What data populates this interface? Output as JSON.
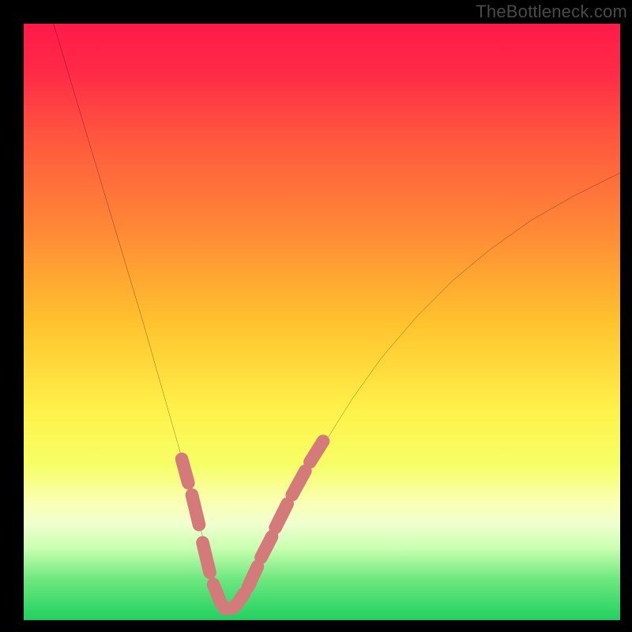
{
  "watermark": "TheBottleneck.com",
  "colors": {
    "frame_bg": "#000000",
    "gradient_stops": [
      {
        "offset": 0.0,
        "color": "#ff1a4a"
      },
      {
        "offset": 0.08,
        "color": "#ff2a47"
      },
      {
        "offset": 0.2,
        "color": "#ff5a3e"
      },
      {
        "offset": 0.35,
        "color": "#ff8a36"
      },
      {
        "offset": 0.5,
        "color": "#ffc22e"
      },
      {
        "offset": 0.65,
        "color": "#fff24a"
      },
      {
        "offset": 0.74,
        "color": "#f6ff66"
      },
      {
        "offset": 0.8,
        "color": "#faffb0"
      },
      {
        "offset": 0.84,
        "color": "#f0ffd0"
      },
      {
        "offset": 0.88,
        "color": "#c8ffb0"
      },
      {
        "offset": 0.93,
        "color": "#70e880"
      },
      {
        "offset": 1.0,
        "color": "#20d060"
      }
    ],
    "curve": "#000000",
    "marker_fill": "#d47a7a",
    "marker_stroke": "#c96a6a"
  },
  "chart_data": {
    "type": "line",
    "title": "",
    "xlabel": "",
    "ylabel": "",
    "xlim": [
      0,
      100
    ],
    "ylim": [
      0,
      100
    ],
    "series": [
      {
        "name": "bottleneck-curve",
        "x": [
          5,
          8,
          11,
          14,
          17,
          20,
          22,
          24,
          26,
          28,
          29,
          30,
          31,
          32,
          33,
          34,
          35,
          36,
          38,
          40,
          43,
          46,
          50,
          55,
          60,
          66,
          72,
          78,
          85,
          92,
          100
        ],
        "y": [
          100,
          90,
          80,
          70,
          60,
          50,
          43,
          36,
          29,
          22,
          18,
          14,
          10,
          7,
          4,
          2,
          2,
          3,
          6,
          10,
          16,
          22,
          29,
          37,
          44,
          51,
          57,
          62,
          67,
          71,
          75
        ]
      }
    ],
    "markers": {
      "name": "highlight-segments",
      "segments": [
        {
          "x0": 26.5,
          "y0": 27,
          "x1": 27.6,
          "y1": 23
        },
        {
          "x0": 28.2,
          "y0": 21,
          "x1": 29.4,
          "y1": 16
        },
        {
          "x0": 30.0,
          "y0": 13,
          "x1": 31.2,
          "y1": 8
        },
        {
          "x0": 31.8,
          "y0": 6,
          "x1": 33.0,
          "y1": 3
        },
        {
          "x0": 33.6,
          "y0": 2,
          "x1": 35.0,
          "y1": 2
        },
        {
          "x0": 35.6,
          "y0": 2.5,
          "x1": 37.0,
          "y1": 4.5
        },
        {
          "x0": 37.6,
          "y0": 5.5,
          "x1": 39.2,
          "y1": 9
        },
        {
          "x0": 39.8,
          "y0": 10.5,
          "x1": 41.6,
          "y1": 14
        },
        {
          "x0": 42.2,
          "y0": 15.5,
          "x1": 44.2,
          "y1": 19.5
        },
        {
          "x0": 45.0,
          "y0": 21,
          "x1": 47.2,
          "y1": 25
        },
        {
          "x0": 48.0,
          "y0": 26.5,
          "x1": 50.2,
          "y1": 30
        }
      ]
    }
  }
}
